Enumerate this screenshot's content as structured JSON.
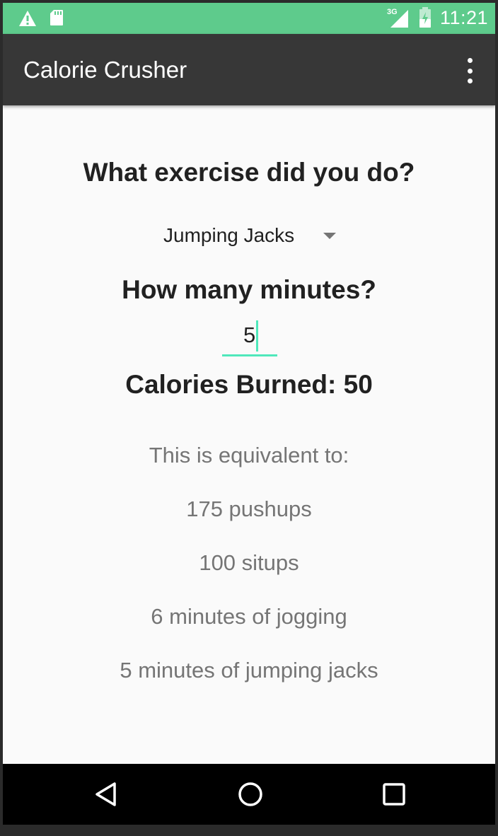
{
  "status_bar": {
    "network_type": "3G",
    "time": "11:21",
    "icons": [
      "warning-icon",
      "sd-card-icon",
      "signal-icon",
      "battery-icon"
    ]
  },
  "app_bar": {
    "title": "Calorie Crusher",
    "icons": [
      "overflow-menu-icon"
    ]
  },
  "form": {
    "exercise_question": "What exercise did you do?",
    "exercise_selected": "Jumping Jacks",
    "minutes_question": "How many minutes?",
    "minutes_value": "5",
    "calories_label": "Calories Burned: 50"
  },
  "equivalents": {
    "heading": "This is equivalent to:",
    "items": [
      "175 pushups",
      "100 situps",
      "6 minutes of jogging",
      "5 minutes of jumping jacks"
    ]
  },
  "nav_bar": {
    "icons": [
      "back-icon",
      "home-icon",
      "recents-icon"
    ]
  },
  "colors": {
    "status_bar": "#5ecb8c",
    "app_bar": "#373737",
    "accent": "#4fe8bb",
    "background": "#fafafa",
    "primary_text": "#212121",
    "secondary_text": "#757575"
  }
}
